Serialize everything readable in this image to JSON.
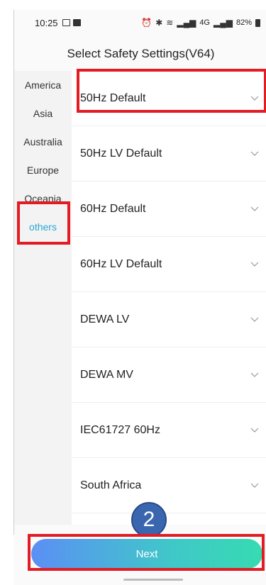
{
  "status_bar": {
    "time": "10:25",
    "signal_text": "4G",
    "battery_percent": "82%"
  },
  "header": {
    "title": "Select Safety Settings(V64)"
  },
  "sidebar": {
    "regions": [
      {
        "label": "America",
        "active": false
      },
      {
        "label": "Asia",
        "active": false
      },
      {
        "label": "Australia",
        "active": false
      },
      {
        "label": "Europe",
        "active": false
      },
      {
        "label": "Oceania",
        "active": false
      },
      {
        "label": "others",
        "active": true
      }
    ]
  },
  "options": [
    {
      "label": "50Hz Default"
    },
    {
      "label": "50Hz LV Default"
    },
    {
      "label": "60Hz Default"
    },
    {
      "label": "60Hz LV Default"
    },
    {
      "label": "DEWA LV"
    },
    {
      "label": "DEWA MV"
    },
    {
      "label": "IEC61727 60Hz"
    },
    {
      "label": "South Africa"
    }
  ],
  "annotation": {
    "step_number": "2"
  },
  "footer": {
    "next_label": "Next"
  },
  "colors": {
    "accent": "#2aa7d8",
    "annotation_red": "#e31b23",
    "badge_blue": "#3a66b0"
  },
  "icons": {
    "option_chevron": "chevron-down-icon"
  }
}
